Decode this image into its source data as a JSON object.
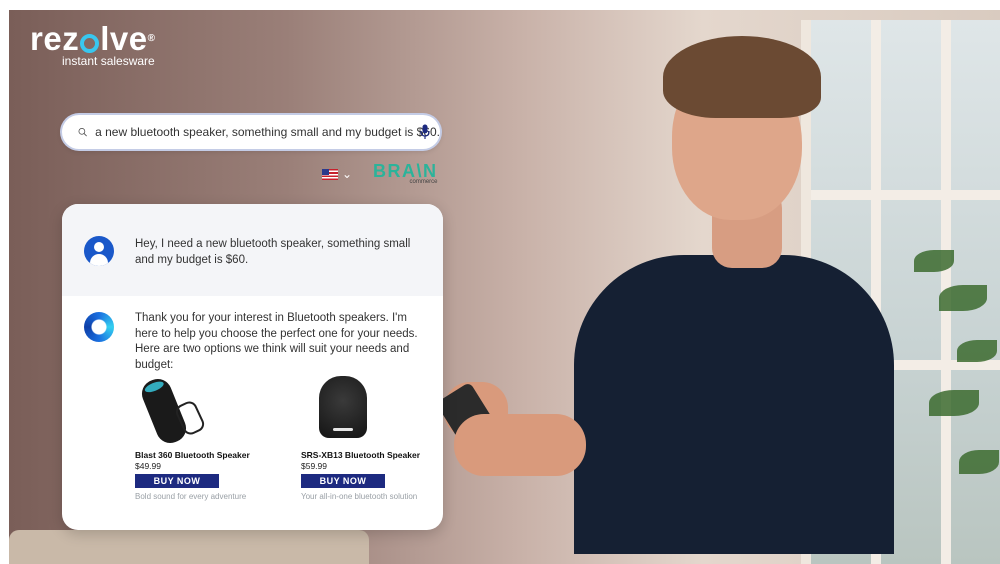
{
  "brand": {
    "name_part1": "rez",
    "name_part2": "lve",
    "registered": "®",
    "tagline": "instant salesware"
  },
  "search": {
    "query": "a new bluetooth speaker, something small and my budget is $60.",
    "icon": "search-icon",
    "mic_icon": "microphone-icon"
  },
  "locale": {
    "flag": "us-flag-icon",
    "chevron": "⌄"
  },
  "partner": {
    "name": "BRA\\N",
    "subtitle": "commerce"
  },
  "chat": {
    "user_message": "Hey, I need a new bluetooth speaker, something small and my budget is $60.",
    "bot_message": "Thank you for your interest in Bluetooth speakers. I'm here to help you choose the perfect one for your needs. Here are two options we think will suit your needs and budget:",
    "products": [
      {
        "name": "Blast 360 Bluetooth Speaker",
        "price": "$49.99",
        "button": "BUY NOW",
        "description": "Bold sound for every adventure"
      },
      {
        "name": "SRS-XB13 Bluetooth Speaker",
        "price": "$59.99",
        "button": "BUY NOW",
        "description": "Your all-in-one bluetooth solution"
      }
    ]
  },
  "colors": {
    "accent": "#38c7ef",
    "button": "#1d2a80",
    "user_avatar": "#1a58c9",
    "partner": "#2bb39a"
  }
}
